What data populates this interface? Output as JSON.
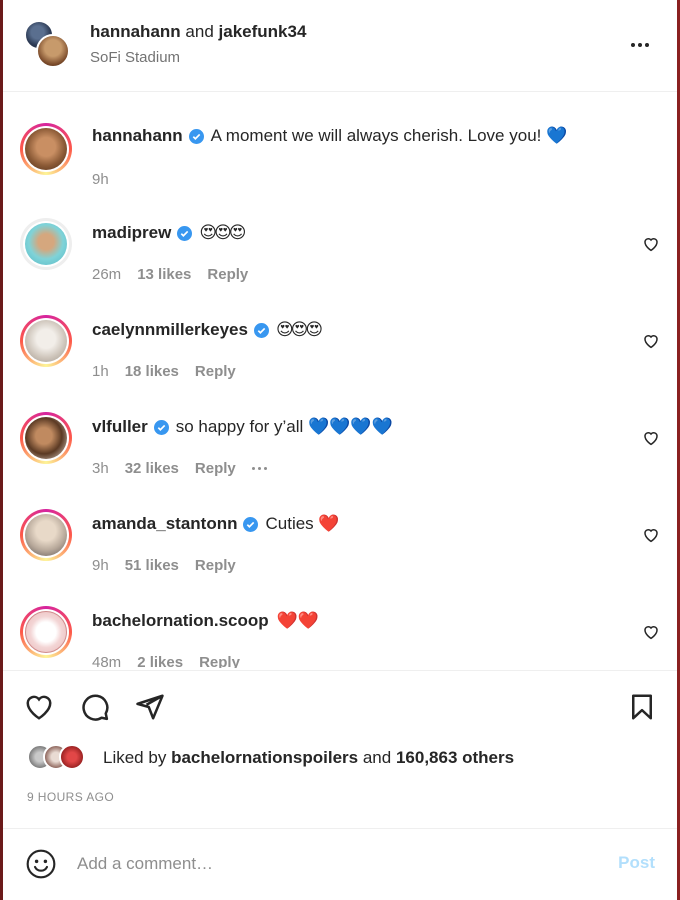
{
  "header": {
    "user1": "hannahann",
    "conjunction": "and",
    "user2": "jakefunk34",
    "location": "SoFi Stadium"
  },
  "caption": {
    "username": "hannahann",
    "text": "A moment we will always cherish. Love you! 💙",
    "time": "9h"
  },
  "comments": [
    {
      "username": "madiprew",
      "text": "😍😍😍",
      "time": "26m",
      "likes": "13 likes",
      "reply": "Reply"
    },
    {
      "username": "caelynnmillerkeyes",
      "text": "😍😍😍",
      "time": "1h",
      "likes": "18 likes",
      "reply": "Reply"
    },
    {
      "username": "vlfuller",
      "text": "so happy for y’all 💙💙💙💙",
      "time": "3h",
      "likes": "32 likes",
      "reply": "Reply"
    },
    {
      "username": "amanda_stantonn",
      "text": "Cuties ❤️",
      "time": "9h",
      "likes": "51 likes",
      "reply": "Reply"
    },
    {
      "username": "bachelornation.scoop",
      "text": "❤️❤️",
      "time": "48m",
      "likes": "2 likes",
      "reply": "Reply"
    }
  ],
  "likes": {
    "prefix": "Liked by",
    "user": "bachelornationspoilers",
    "middle": "and",
    "count": "160,863 others"
  },
  "timestamp": "9 HOURS AGO",
  "add_comment": {
    "placeholder": "Add a comment…",
    "post_label": "Post"
  },
  "colors": {
    "verified": "#3897f0",
    "post_disabled": "#b2dffc",
    "secondary_text": "#8e8e8e"
  }
}
